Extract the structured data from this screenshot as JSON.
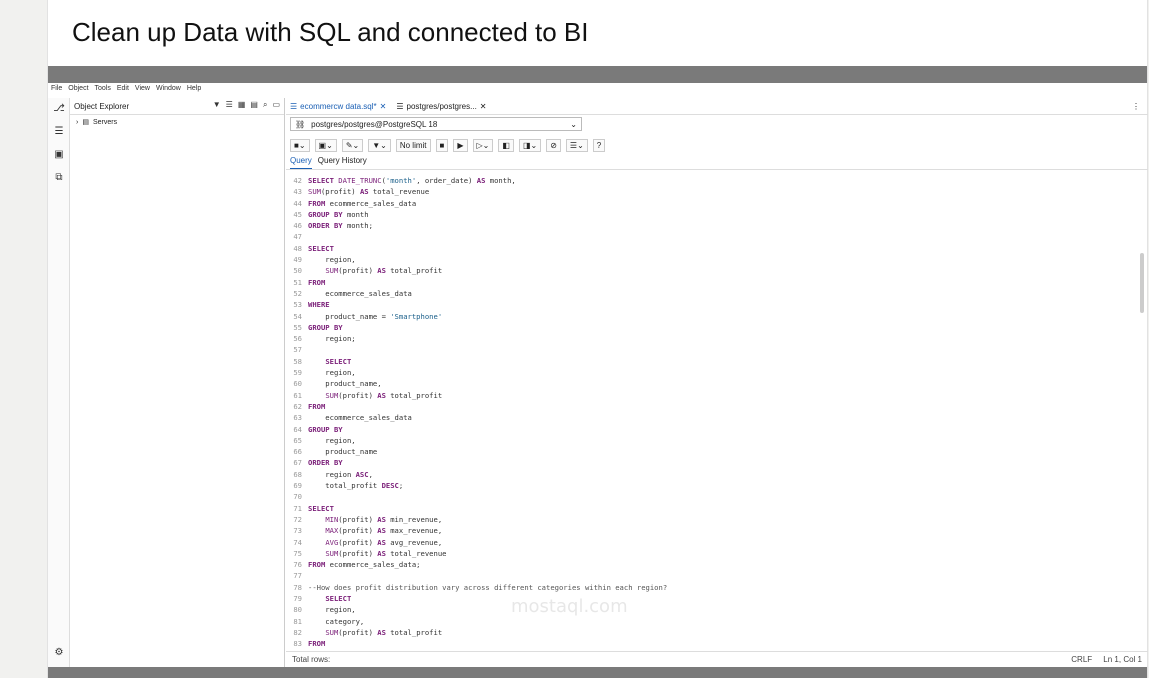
{
  "card": {
    "title": "Clean up Data with SQL and connected to BI"
  },
  "menu": [
    "File",
    "Object",
    "Tools",
    "Edit",
    "View",
    "Window",
    "Help"
  ],
  "explorer": {
    "title": "Object Explorer",
    "servers": "Servers"
  },
  "tabs": [
    {
      "label": "ecommercw data.sql*"
    },
    {
      "label": "postgres/postgres..."
    }
  ],
  "connection": "postgres/postgres@PostgreSQL 18",
  "toolbar": {
    "limit": "No limit"
  },
  "subtabs": [
    "Query",
    "Query History"
  ],
  "code": [
    {
      "n": 42,
      "t": "SELECT DATE_TRUNC('month', order_date) AS month,"
    },
    {
      "n": 43,
      "t": "SUM(profit) AS total_revenue"
    },
    {
      "n": 44,
      "t": "FROM ecommerce_sales_data"
    },
    {
      "n": 45,
      "t": "GROUP BY month"
    },
    {
      "n": 46,
      "t": "ORDER BY month;"
    },
    {
      "n": 47,
      "t": ""
    },
    {
      "n": 48,
      "t": "SELECT"
    },
    {
      "n": 49,
      "t": "    region,"
    },
    {
      "n": 50,
      "t": "    SUM(profit) AS total_profit"
    },
    {
      "n": 51,
      "t": "FROM"
    },
    {
      "n": 52,
      "t": "    ecommerce_sales_data"
    },
    {
      "n": 53,
      "t": "WHERE"
    },
    {
      "n": 54,
      "t": "    product_name = 'Smartphone'"
    },
    {
      "n": 55,
      "t": "GROUP BY"
    },
    {
      "n": 56,
      "t": "    region;"
    },
    {
      "n": 57,
      "t": ""
    },
    {
      "n": 58,
      "t": "    SELECT"
    },
    {
      "n": 59,
      "t": "    region,"
    },
    {
      "n": 60,
      "t": "    product_name,"
    },
    {
      "n": 61,
      "t": "    SUM(profit) AS total_profit"
    },
    {
      "n": 62,
      "t": "FROM"
    },
    {
      "n": 63,
      "t": "    ecommerce_sales_data"
    },
    {
      "n": 64,
      "t": "GROUP BY"
    },
    {
      "n": 65,
      "t": "    region,"
    },
    {
      "n": 66,
      "t": "    product_name"
    },
    {
      "n": 67,
      "t": "ORDER BY"
    },
    {
      "n": 68,
      "t": "    region ASC,"
    },
    {
      "n": 69,
      "t": "    total_profit DESC;"
    },
    {
      "n": 70,
      "t": ""
    },
    {
      "n": 71,
      "t": "SELECT"
    },
    {
      "n": 72,
      "t": "    MIN(profit) AS min_revenue,"
    },
    {
      "n": 73,
      "t": "    MAX(profit) AS max_revenue,"
    },
    {
      "n": 74,
      "t": "    AVG(profit) AS avg_revenue,"
    },
    {
      "n": 75,
      "t": "    SUM(profit) AS total_revenue"
    },
    {
      "n": 76,
      "t": "FROM ecommerce_sales_data;"
    },
    {
      "n": 77,
      "t": ""
    },
    {
      "n": 78,
      "t": "--How does profit distribution vary across different categories within each region?"
    },
    {
      "n": 79,
      "t": "    SELECT"
    },
    {
      "n": 80,
      "t": "    region,"
    },
    {
      "n": 81,
      "t": "    category,"
    },
    {
      "n": 82,
      "t": "    SUM(profit) AS total_profit"
    },
    {
      "n": 83,
      "t": "FROM"
    }
  ],
  "status": {
    "rows": "Total rows:",
    "eol": "CRLF",
    "pos": "Ln 1, Col 1"
  },
  "watermark": "mostaql.com"
}
